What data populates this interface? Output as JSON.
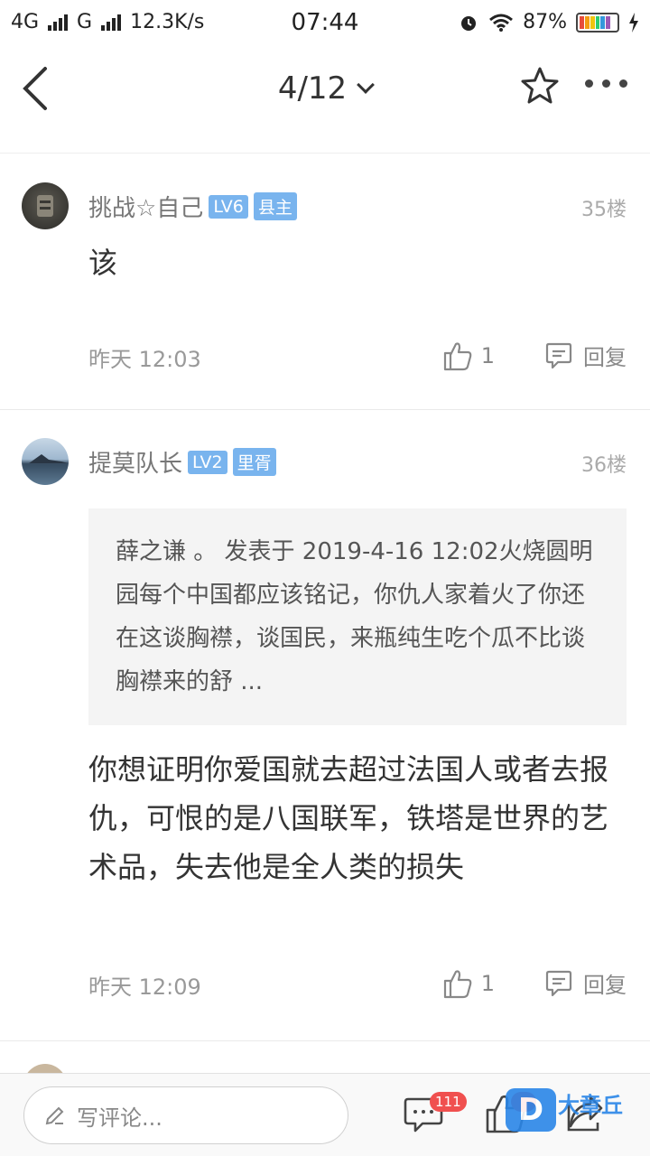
{
  "status_bar": {
    "network1": "4G",
    "network2": "G",
    "speed": "12.3K/s",
    "time": "07:44",
    "battery": "87%"
  },
  "nav": {
    "page_indicator": "4/12"
  },
  "posts": [
    {
      "user": "挑战☆自己",
      "level": "LV6",
      "title": "县主",
      "floor": "35楼",
      "content": "该",
      "time": "昨天 12:03",
      "likes": "1",
      "reply_label": "回复"
    },
    {
      "user": "提莫队长",
      "level": "LV2",
      "title": "里胥",
      "floor": "36楼",
      "quote": "薛之谦 。 发表于 2019-4-16 12:02火烧圆明园每个中国都应该铭记，你仇人家着火了你还在这谈胸襟，谈国民，来瓶纯生吃个瓜不比谈胸襟来的舒 ...",
      "content": "你想证明你爱国就去超过法国人或者去报仇，可恨的是八国联军，铁塔是世界的艺术品，失去他是全人类的损失",
      "time": "昨天 12:09",
      "likes": "1",
      "reply_label": "回复"
    }
  ],
  "bottom_bar": {
    "comment_placeholder": "写评论...",
    "comment_count": "111",
    "watermark_logo": "D",
    "watermark_text": "大章丘"
  },
  "colors": {
    "badge_blue": "#79b4ee",
    "count_red": "#f0504f",
    "watermark_blue": "#2a86e8"
  }
}
